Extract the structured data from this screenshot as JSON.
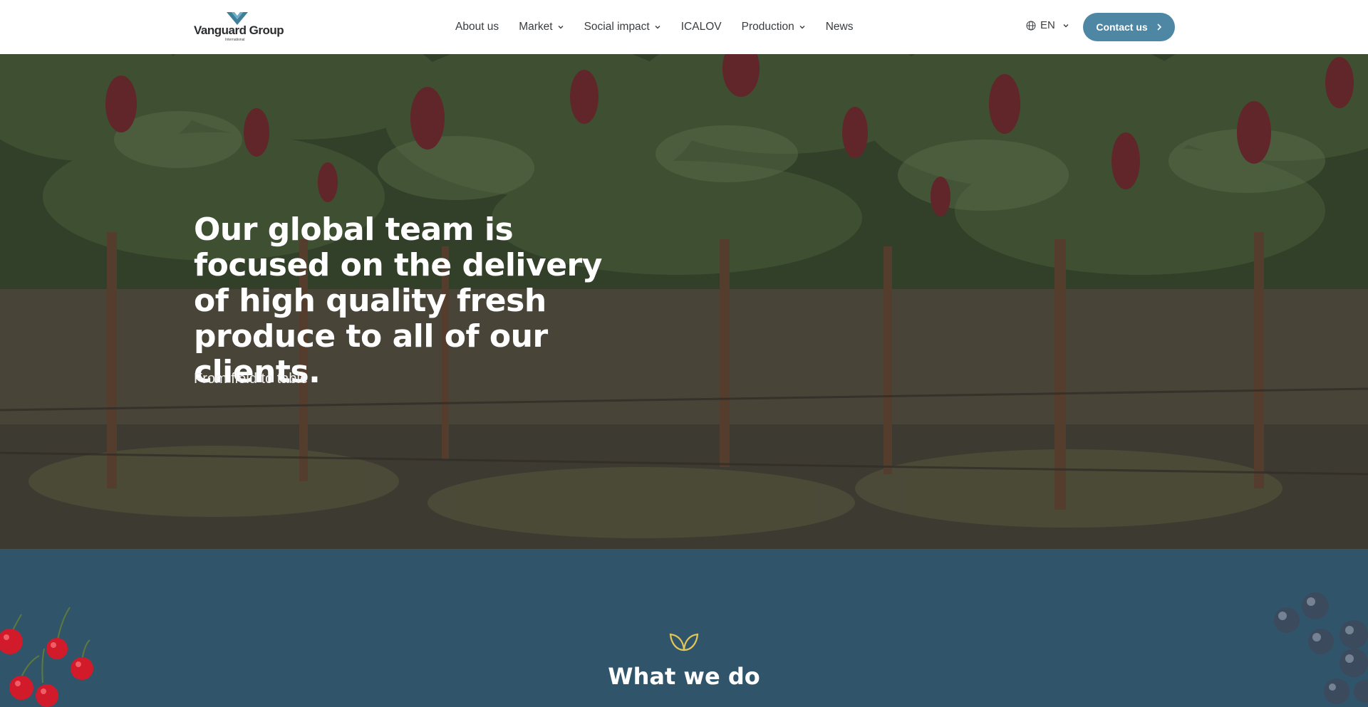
{
  "header": {
    "logo": {
      "name": "Vanguard Group",
      "subtitle": "International"
    },
    "nav": [
      {
        "label": "About us",
        "dropdown": false
      },
      {
        "label": "Market",
        "dropdown": true
      },
      {
        "label": "Social impact",
        "dropdown": true
      },
      {
        "label": "ICALOV",
        "dropdown": false
      },
      {
        "label": "Production",
        "dropdown": true
      },
      {
        "label": "News",
        "dropdown": false
      }
    ],
    "language": "EN",
    "contact_label": "Contact us"
  },
  "hero": {
    "title": "Our global team is focused on the delivery of high quality fresh produce to all of our clients.",
    "subtitle": "From field to table"
  },
  "section": {
    "title": "What we do"
  },
  "colors": {
    "accent": "#4e87a3",
    "section_bg": "#30556b",
    "leaf_icon": "#e0c65a"
  },
  "icons": [
    "leaf-icon",
    "globe-icon",
    "chevron-down-icon",
    "chevron-right-icon"
  ]
}
